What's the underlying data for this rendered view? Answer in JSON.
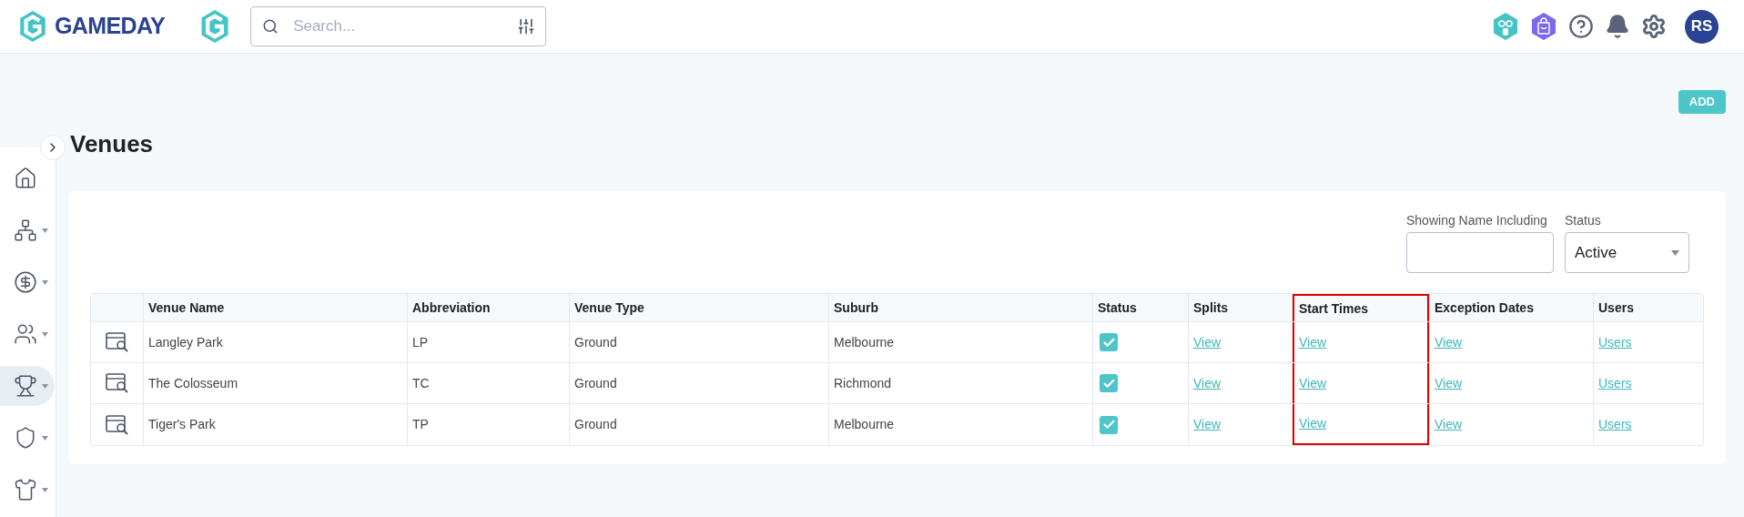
{
  "header": {
    "logo_text": "GAMEDAY",
    "search": {
      "placeholder": "Search..."
    },
    "avatar_initials": "RS"
  },
  "sidebar": {
    "items": [
      {
        "selected": false,
        "has_menu": false
      },
      {
        "selected": false,
        "has_menu": true
      },
      {
        "selected": false,
        "has_menu": true
      },
      {
        "selected": false,
        "has_menu": true
      },
      {
        "selected": true,
        "has_menu": true
      },
      {
        "selected": false,
        "has_menu": true
      },
      {
        "selected": false,
        "has_menu": true
      }
    ]
  },
  "page": {
    "title": "Venues",
    "add_button": "ADD"
  },
  "filters": {
    "name_label": "Showing Name Including",
    "status_label": "Status",
    "status_value": "Active"
  },
  "table": {
    "columns": [
      {
        "label": "Venue Name",
        "highlighted": false
      },
      {
        "label": "Abbreviation",
        "highlighted": false
      },
      {
        "label": "Venue Type",
        "highlighted": false
      },
      {
        "label": "Suburb",
        "highlighted": false
      },
      {
        "label": "Status",
        "highlighted": false
      },
      {
        "label": "Splits",
        "highlighted": false
      },
      {
        "label": "Start Times",
        "highlighted": true
      },
      {
        "label": "Exception Dates",
        "highlighted": false
      },
      {
        "label": "Users",
        "highlighted": false
      }
    ],
    "rows": [
      {
        "name": "Langley Park",
        "abbreviation": "LP",
        "type": "Ground",
        "suburb": "Melbourne",
        "checked": true,
        "splits": "View",
        "start_times": "View",
        "exception_dates": "View",
        "users": "Users"
      },
      {
        "name": "The Colosseum",
        "abbreviation": "TC",
        "type": "Ground",
        "suburb": "Richmond",
        "checked": true,
        "splits": "View",
        "start_times": "View",
        "exception_dates": "View",
        "users": "Users"
      },
      {
        "name": "Tiger's Park",
        "abbreviation": "TP",
        "type": "Ground",
        "suburb": "Melbourne",
        "checked": true,
        "splits": "View",
        "start_times": "View",
        "exception_dates": "View",
        "users": "Users"
      }
    ]
  }
}
